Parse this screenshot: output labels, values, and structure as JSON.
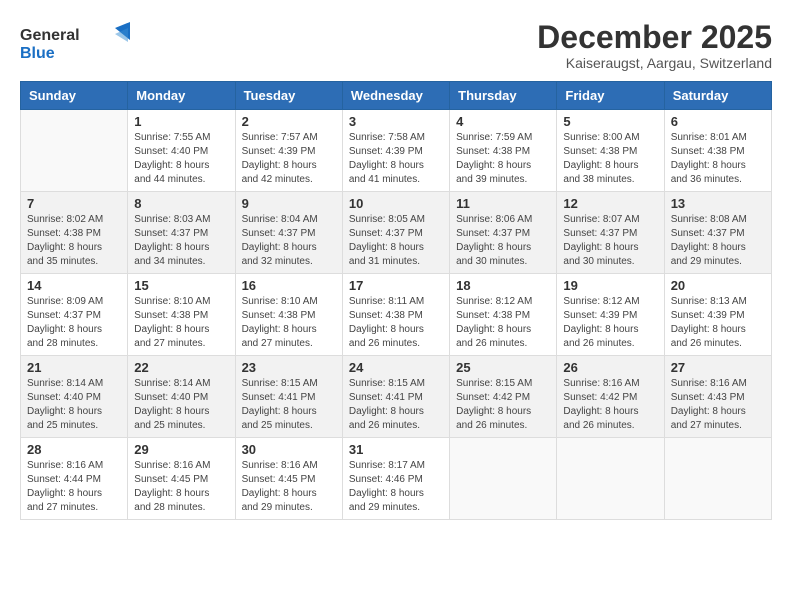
{
  "header": {
    "logo_general": "General",
    "logo_blue": "Blue",
    "month_title": "December 2025",
    "location": "Kaiseraugst, Aargau, Switzerland"
  },
  "weekdays": [
    "Sunday",
    "Monday",
    "Tuesday",
    "Wednesday",
    "Thursday",
    "Friday",
    "Saturday"
  ],
  "weeks": [
    [
      {
        "day": "",
        "empty": true
      },
      {
        "day": "1",
        "sunrise": "7:55 AM",
        "sunset": "4:40 PM",
        "daylight": "8 hours and 44 minutes."
      },
      {
        "day": "2",
        "sunrise": "7:57 AM",
        "sunset": "4:39 PM",
        "daylight": "8 hours and 42 minutes."
      },
      {
        "day": "3",
        "sunrise": "7:58 AM",
        "sunset": "4:39 PM",
        "daylight": "8 hours and 41 minutes."
      },
      {
        "day": "4",
        "sunrise": "7:59 AM",
        "sunset": "4:38 PM",
        "daylight": "8 hours and 39 minutes."
      },
      {
        "day": "5",
        "sunrise": "8:00 AM",
        "sunset": "4:38 PM",
        "daylight": "8 hours and 38 minutes."
      },
      {
        "day": "6",
        "sunrise": "8:01 AM",
        "sunset": "4:38 PM",
        "daylight": "8 hours and 36 minutes."
      }
    ],
    [
      {
        "day": "7",
        "sunrise": "8:02 AM",
        "sunset": "4:38 PM",
        "daylight": "8 hours and 35 minutes."
      },
      {
        "day": "8",
        "sunrise": "8:03 AM",
        "sunset": "4:37 PM",
        "daylight": "8 hours and 34 minutes."
      },
      {
        "day": "9",
        "sunrise": "8:04 AM",
        "sunset": "4:37 PM",
        "daylight": "8 hours and 32 minutes."
      },
      {
        "day": "10",
        "sunrise": "8:05 AM",
        "sunset": "4:37 PM",
        "daylight": "8 hours and 31 minutes."
      },
      {
        "day": "11",
        "sunrise": "8:06 AM",
        "sunset": "4:37 PM",
        "daylight": "8 hours and 30 minutes."
      },
      {
        "day": "12",
        "sunrise": "8:07 AM",
        "sunset": "4:37 PM",
        "daylight": "8 hours and 30 minutes."
      },
      {
        "day": "13",
        "sunrise": "8:08 AM",
        "sunset": "4:37 PM",
        "daylight": "8 hours and 29 minutes."
      }
    ],
    [
      {
        "day": "14",
        "sunrise": "8:09 AM",
        "sunset": "4:37 PM",
        "daylight": "8 hours and 28 minutes."
      },
      {
        "day": "15",
        "sunrise": "8:10 AM",
        "sunset": "4:38 PM",
        "daylight": "8 hours and 27 minutes."
      },
      {
        "day": "16",
        "sunrise": "8:10 AM",
        "sunset": "4:38 PM",
        "daylight": "8 hours and 27 minutes."
      },
      {
        "day": "17",
        "sunrise": "8:11 AM",
        "sunset": "4:38 PM",
        "daylight": "8 hours and 26 minutes."
      },
      {
        "day": "18",
        "sunrise": "8:12 AM",
        "sunset": "4:38 PM",
        "daylight": "8 hours and 26 minutes."
      },
      {
        "day": "19",
        "sunrise": "8:12 AM",
        "sunset": "4:39 PM",
        "daylight": "8 hours and 26 minutes."
      },
      {
        "day": "20",
        "sunrise": "8:13 AM",
        "sunset": "4:39 PM",
        "daylight": "8 hours and 26 minutes."
      }
    ],
    [
      {
        "day": "21",
        "sunrise": "8:14 AM",
        "sunset": "4:40 PM",
        "daylight": "8 hours and 25 minutes."
      },
      {
        "day": "22",
        "sunrise": "8:14 AM",
        "sunset": "4:40 PM",
        "daylight": "8 hours and 25 minutes."
      },
      {
        "day": "23",
        "sunrise": "8:15 AM",
        "sunset": "4:41 PM",
        "daylight": "8 hours and 25 minutes."
      },
      {
        "day": "24",
        "sunrise": "8:15 AM",
        "sunset": "4:41 PM",
        "daylight": "8 hours and 26 minutes."
      },
      {
        "day": "25",
        "sunrise": "8:15 AM",
        "sunset": "4:42 PM",
        "daylight": "8 hours and 26 minutes."
      },
      {
        "day": "26",
        "sunrise": "8:16 AM",
        "sunset": "4:42 PM",
        "daylight": "8 hours and 26 minutes."
      },
      {
        "day": "27",
        "sunrise": "8:16 AM",
        "sunset": "4:43 PM",
        "daylight": "8 hours and 27 minutes."
      }
    ],
    [
      {
        "day": "28",
        "sunrise": "8:16 AM",
        "sunset": "4:44 PM",
        "daylight": "8 hours and 27 minutes."
      },
      {
        "day": "29",
        "sunrise": "8:16 AM",
        "sunset": "4:45 PM",
        "daylight": "8 hours and 28 minutes."
      },
      {
        "day": "30",
        "sunrise": "8:16 AM",
        "sunset": "4:45 PM",
        "daylight": "8 hours and 29 minutes."
      },
      {
        "day": "31",
        "sunrise": "8:17 AM",
        "sunset": "4:46 PM",
        "daylight": "8 hours and 29 minutes."
      },
      {
        "day": "",
        "empty": true
      },
      {
        "day": "",
        "empty": true
      },
      {
        "day": "",
        "empty": true
      }
    ]
  ],
  "labels": {
    "sunrise": "Sunrise:",
    "sunset": "Sunset:",
    "daylight": "Daylight:"
  }
}
